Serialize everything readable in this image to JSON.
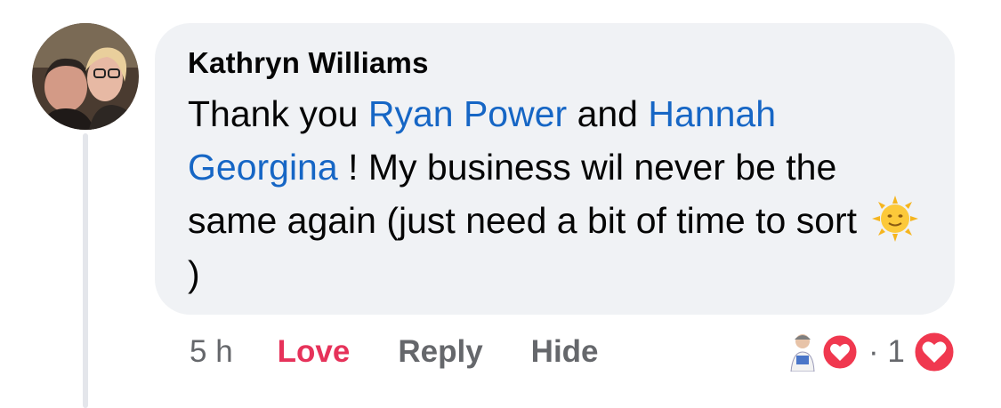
{
  "comment": {
    "author": "Kathryn Williams",
    "text_part1": "Thank you ",
    "mention1": "Ryan Power",
    "text_part2": " and ",
    "mention2": "Hannah Georgina",
    "text_part3": " !  My business wil never be the same again (just need a bit of time to sort ",
    "text_part4": ")",
    "emoji": "sun-with-face-emoji"
  },
  "actions": {
    "timestamp": "5 h",
    "love_label": "Love",
    "reply_label": "Reply",
    "hide_label": "Hide"
  },
  "reactions": {
    "count": "· 1",
    "reactor_icon": "reactor-avatar-icon",
    "reaction_type": "love-heart-icon"
  },
  "colors": {
    "mention": "#1666c5",
    "love_active": "#e6325a",
    "bubble_bg": "#f0f2f5",
    "muted_text": "#65676b"
  }
}
